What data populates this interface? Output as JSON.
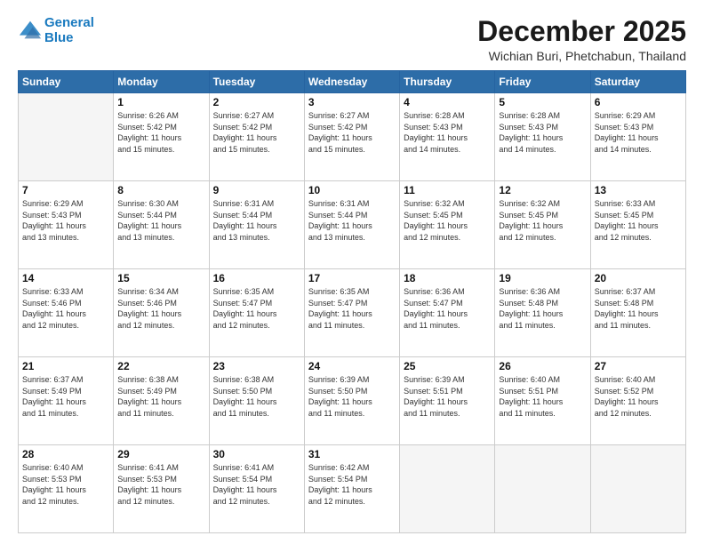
{
  "header": {
    "logo_line1": "General",
    "logo_line2": "Blue",
    "month_title": "December 2025",
    "location": "Wichian Buri, Phetchabun, Thailand"
  },
  "days_of_week": [
    "Sunday",
    "Monday",
    "Tuesday",
    "Wednesday",
    "Thursday",
    "Friday",
    "Saturday"
  ],
  "weeks": [
    [
      {
        "day": "",
        "info": ""
      },
      {
        "day": "1",
        "info": "Sunrise: 6:26 AM\nSunset: 5:42 PM\nDaylight: 11 hours\nand 15 minutes."
      },
      {
        "day": "2",
        "info": "Sunrise: 6:27 AM\nSunset: 5:42 PM\nDaylight: 11 hours\nand 15 minutes."
      },
      {
        "day": "3",
        "info": "Sunrise: 6:27 AM\nSunset: 5:42 PM\nDaylight: 11 hours\nand 15 minutes."
      },
      {
        "day": "4",
        "info": "Sunrise: 6:28 AM\nSunset: 5:43 PM\nDaylight: 11 hours\nand 14 minutes."
      },
      {
        "day": "5",
        "info": "Sunrise: 6:28 AM\nSunset: 5:43 PM\nDaylight: 11 hours\nand 14 minutes."
      },
      {
        "day": "6",
        "info": "Sunrise: 6:29 AM\nSunset: 5:43 PM\nDaylight: 11 hours\nand 14 minutes."
      }
    ],
    [
      {
        "day": "7",
        "info": "Sunrise: 6:29 AM\nSunset: 5:43 PM\nDaylight: 11 hours\nand 13 minutes."
      },
      {
        "day": "8",
        "info": "Sunrise: 6:30 AM\nSunset: 5:44 PM\nDaylight: 11 hours\nand 13 minutes."
      },
      {
        "day": "9",
        "info": "Sunrise: 6:31 AM\nSunset: 5:44 PM\nDaylight: 11 hours\nand 13 minutes."
      },
      {
        "day": "10",
        "info": "Sunrise: 6:31 AM\nSunset: 5:44 PM\nDaylight: 11 hours\nand 13 minutes."
      },
      {
        "day": "11",
        "info": "Sunrise: 6:32 AM\nSunset: 5:45 PM\nDaylight: 11 hours\nand 12 minutes."
      },
      {
        "day": "12",
        "info": "Sunrise: 6:32 AM\nSunset: 5:45 PM\nDaylight: 11 hours\nand 12 minutes."
      },
      {
        "day": "13",
        "info": "Sunrise: 6:33 AM\nSunset: 5:45 PM\nDaylight: 11 hours\nand 12 minutes."
      }
    ],
    [
      {
        "day": "14",
        "info": "Sunrise: 6:33 AM\nSunset: 5:46 PM\nDaylight: 11 hours\nand 12 minutes."
      },
      {
        "day": "15",
        "info": "Sunrise: 6:34 AM\nSunset: 5:46 PM\nDaylight: 11 hours\nand 12 minutes."
      },
      {
        "day": "16",
        "info": "Sunrise: 6:35 AM\nSunset: 5:47 PM\nDaylight: 11 hours\nand 12 minutes."
      },
      {
        "day": "17",
        "info": "Sunrise: 6:35 AM\nSunset: 5:47 PM\nDaylight: 11 hours\nand 11 minutes."
      },
      {
        "day": "18",
        "info": "Sunrise: 6:36 AM\nSunset: 5:47 PM\nDaylight: 11 hours\nand 11 minutes."
      },
      {
        "day": "19",
        "info": "Sunrise: 6:36 AM\nSunset: 5:48 PM\nDaylight: 11 hours\nand 11 minutes."
      },
      {
        "day": "20",
        "info": "Sunrise: 6:37 AM\nSunset: 5:48 PM\nDaylight: 11 hours\nand 11 minutes."
      }
    ],
    [
      {
        "day": "21",
        "info": "Sunrise: 6:37 AM\nSunset: 5:49 PM\nDaylight: 11 hours\nand 11 minutes."
      },
      {
        "day": "22",
        "info": "Sunrise: 6:38 AM\nSunset: 5:49 PM\nDaylight: 11 hours\nand 11 minutes."
      },
      {
        "day": "23",
        "info": "Sunrise: 6:38 AM\nSunset: 5:50 PM\nDaylight: 11 hours\nand 11 minutes."
      },
      {
        "day": "24",
        "info": "Sunrise: 6:39 AM\nSunset: 5:50 PM\nDaylight: 11 hours\nand 11 minutes."
      },
      {
        "day": "25",
        "info": "Sunrise: 6:39 AM\nSunset: 5:51 PM\nDaylight: 11 hours\nand 11 minutes."
      },
      {
        "day": "26",
        "info": "Sunrise: 6:40 AM\nSunset: 5:51 PM\nDaylight: 11 hours\nand 11 minutes."
      },
      {
        "day": "27",
        "info": "Sunrise: 6:40 AM\nSunset: 5:52 PM\nDaylight: 11 hours\nand 12 minutes."
      }
    ],
    [
      {
        "day": "28",
        "info": "Sunrise: 6:40 AM\nSunset: 5:53 PM\nDaylight: 11 hours\nand 12 minutes."
      },
      {
        "day": "29",
        "info": "Sunrise: 6:41 AM\nSunset: 5:53 PM\nDaylight: 11 hours\nand 12 minutes."
      },
      {
        "day": "30",
        "info": "Sunrise: 6:41 AM\nSunset: 5:54 PM\nDaylight: 11 hours\nand 12 minutes."
      },
      {
        "day": "31",
        "info": "Sunrise: 6:42 AM\nSunset: 5:54 PM\nDaylight: 11 hours\nand 12 minutes."
      },
      {
        "day": "",
        "info": ""
      },
      {
        "day": "",
        "info": ""
      },
      {
        "day": "",
        "info": ""
      }
    ]
  ]
}
